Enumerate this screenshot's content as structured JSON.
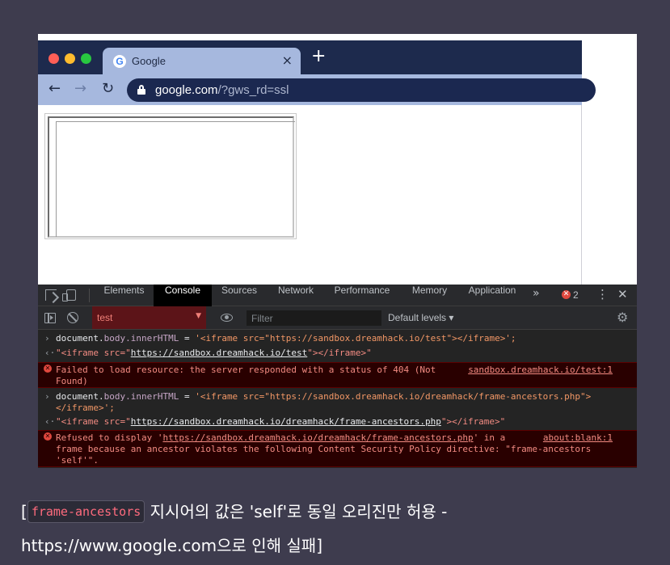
{
  "browser": {
    "tab_title": "Google",
    "tab_close": "×",
    "new_tab": "+",
    "url_host": "google.com",
    "url_path": "/?gws_rd=ssl"
  },
  "devtools": {
    "tabs": [
      "Elements",
      "Console",
      "Sources",
      "Network",
      "Performance",
      "Memory",
      "Application"
    ],
    "active_tab": "Console",
    "more": "»",
    "error_count": "2",
    "context": "test",
    "filter_placeholder": "Filter",
    "levels": "Default levels ▾",
    "console": {
      "cmd1": {
        "prefix": "document.",
        "prop": "body.innerHTML",
        "op": " = ",
        "value": "'<iframe src=\"https://sandbox.dreamhack.io/test\"></iframe>';"
      },
      "result1": {
        "open": "\"<iframe src=\"",
        "link": "https://sandbox.dreamhack.io/test",
        "close": "\"></iframe>\""
      },
      "error1": {
        "line1": "Failed to load resource: the server responded with a status of 404 (Not",
        "line2": "Found)",
        "source": "sandbox.dreamhack.io/test:1"
      },
      "cmd2": {
        "prefix": "document.",
        "prop": "body.innerHTML",
        "op": " = ",
        "value_line1": "'<iframe src=\"https://sandbox.dreamhack.io/dreamhack/frame-ancestors.php\">",
        "value_line2": "</iframe>';"
      },
      "result2": {
        "open": "\"<iframe src=\"",
        "link": "https://sandbox.dreamhack.io/dreamhack/frame-ancestors.php",
        "close": "\"></iframe>\""
      },
      "error2": {
        "line1_pre": "Refused to display '",
        "line1_link": "https://sandbox.dreamhack.io/dreamhack/frame-ancestors.php",
        "line1_post": "' in a",
        "line2": "frame because an ancestor violates the following Content Security Policy directive: \"frame-ancestors",
        "line3": "'self'\".",
        "source": "about:blank:1"
      }
    }
  },
  "caption": {
    "open": "[",
    "code": "frame-ancestors",
    "line1": " 지시어의 값은 'self'로 동일 오리진만 허용 -",
    "line2": "https://www.google.com으로 인해 실패]"
  },
  "colors": {
    "page_bg": "#3e3c4e",
    "tab_bg": "#a6b8de",
    "tabstrip_bg": "#1d2a4d",
    "devtools_bg": "#242424",
    "error_text": "#f28b82",
    "code_accent": "#ff6b7d"
  }
}
